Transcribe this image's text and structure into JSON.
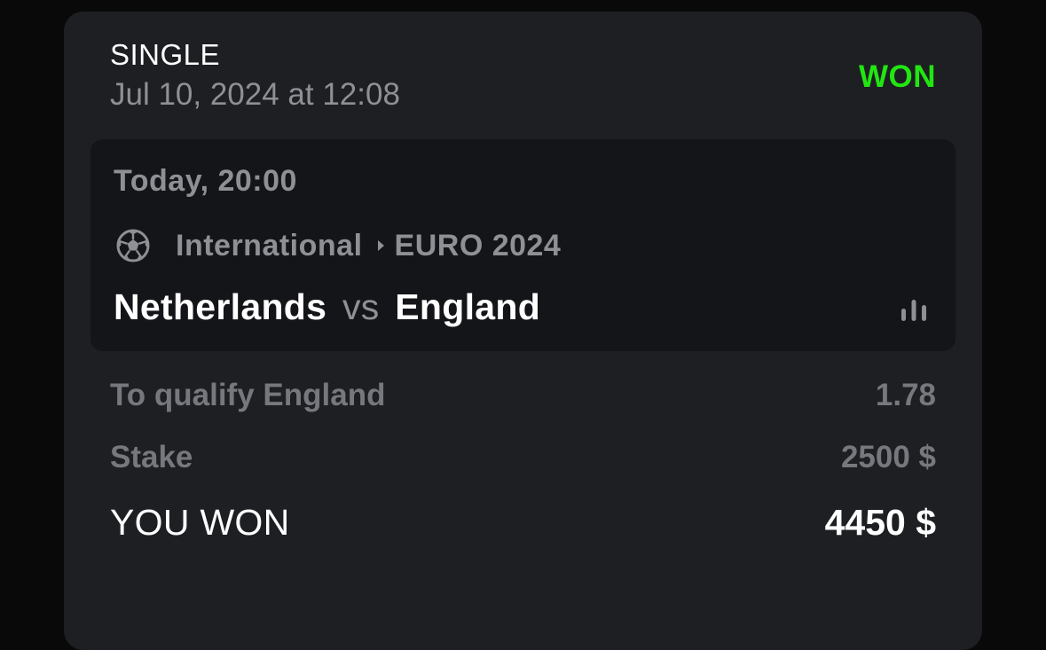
{
  "bet": {
    "type": "SINGLE",
    "placed_at": "Jul 10, 2024 at 12:08",
    "status": "WON",
    "status_color": "#22e512"
  },
  "event": {
    "time": "Today, 20:00",
    "sport_icon": "soccer-ball-icon",
    "category": "International",
    "league": "EURO 2024",
    "home_team": "Netherlands",
    "separator": "vs",
    "away_team": "England",
    "stats_icon": "stats-bars-icon"
  },
  "details": {
    "selection_label": "To qualify England",
    "odds": "1.78",
    "stake_label": "Stake",
    "stake_value": "2500 $",
    "payout_label": "YOU WON",
    "payout_value": "4450 $"
  }
}
